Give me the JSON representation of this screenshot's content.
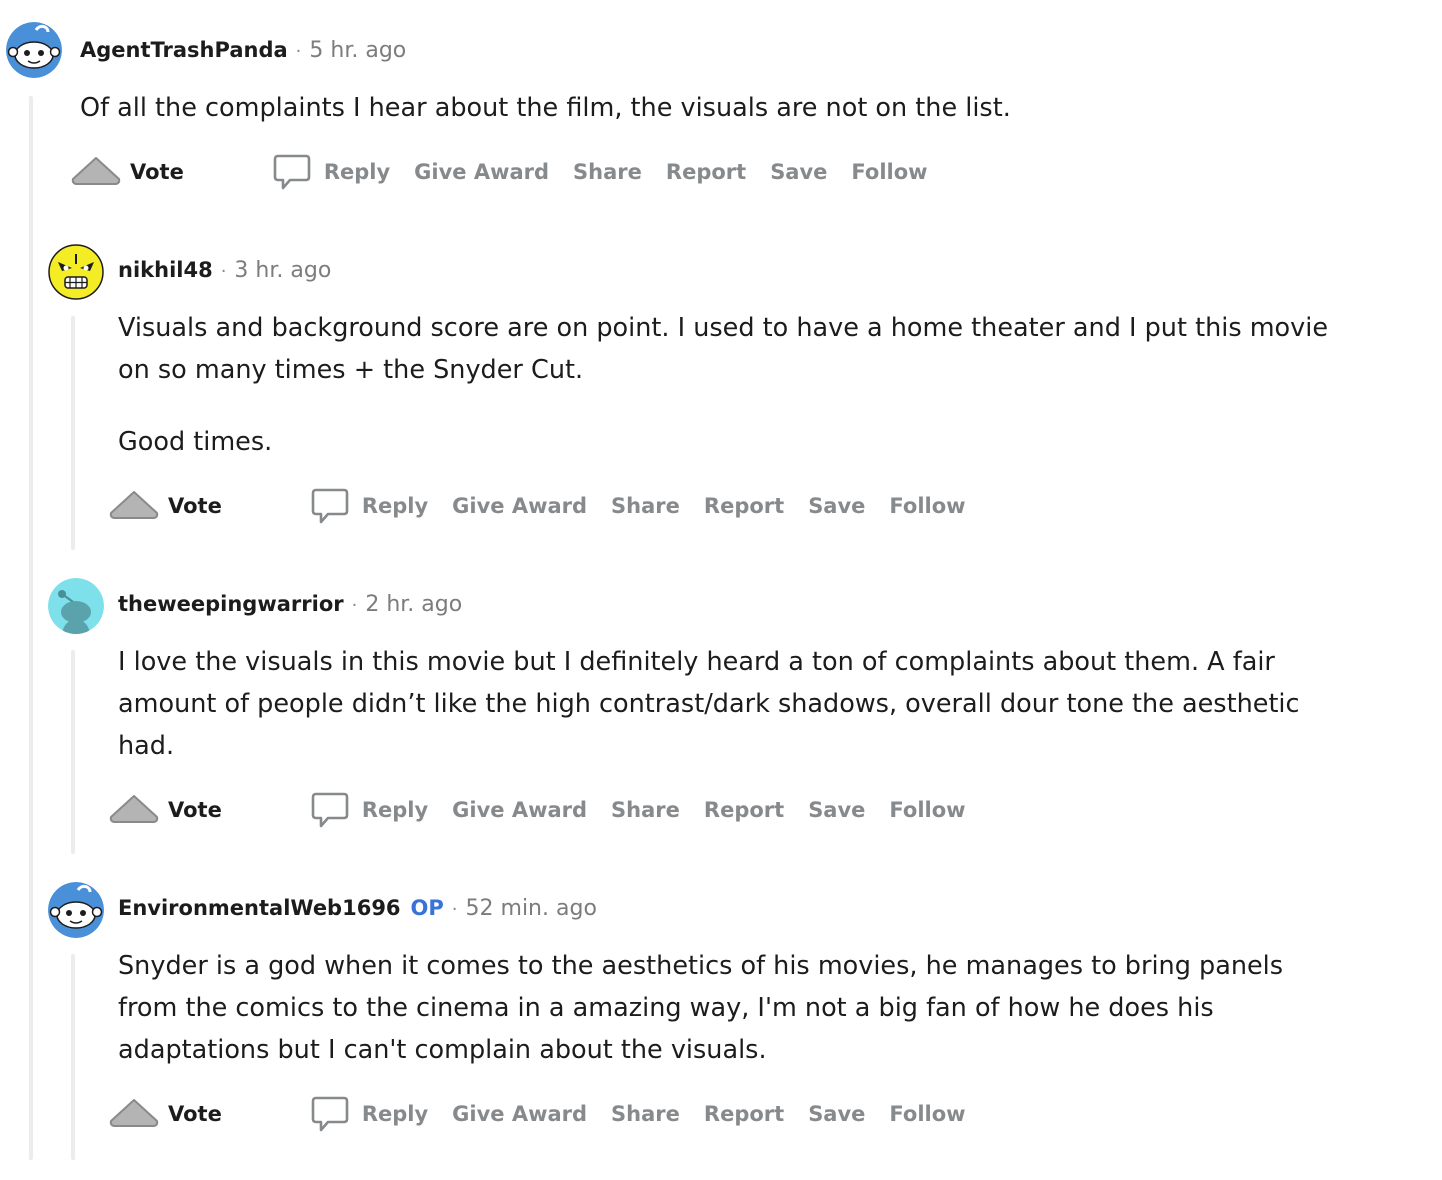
{
  "comments": [
    {
      "username": "AgentTrashPanda",
      "op": "",
      "separator": "·",
      "time": "5 hr. ago",
      "avatar": "snoo-blue-avatar",
      "paragraphs": [
        "Of all the complaints I hear about the film, the visuals are not on the list."
      ]
    },
    {
      "username": "nikhil48",
      "op": "",
      "separator": "·",
      "time": "3 hr. ago",
      "avatar": "yellow-skull-avatar",
      "paragraphs": [
        "Visuals and background score are on point. I used to have a home theater and I put this movie on so many times + the Snyder Cut.",
        "Good times."
      ]
    },
    {
      "username": "theweepingwarrior",
      "op": "",
      "separator": "·",
      "time": "2 hr. ago",
      "avatar": "teal-snoo-avatar",
      "paragraphs": [
        "I love the visuals in this movie but I definitely heard a ton of complaints about them. A fair amount of people didn’t like the high contrast/dark shadows, overall dour tone the aesthetic had."
      ]
    },
    {
      "username": "EnvironmentalWeb1696",
      "op": "OP",
      "separator": "·",
      "time": "52 min. ago",
      "avatar": "snoo-blue-avatar",
      "paragraphs": [
        "Snyder is a god when it comes to the aesthetics of his movies, he manages to bring panels from the comics to the cinema in a amazing way, I'm not a big fan of how he does his adaptations but I can't complain about the visuals."
      ]
    }
  ],
  "actions": {
    "vote": "Vote",
    "reply": "Reply",
    "give_award": "Give Award",
    "share": "Share",
    "report": "Report",
    "save": "Save",
    "follow": "Follow"
  },
  "colors": {
    "thread_line": "#ececec",
    "op_badge": "#3873d6",
    "action_text": "#878a8c",
    "snoo_blue": "#4a90d9"
  }
}
